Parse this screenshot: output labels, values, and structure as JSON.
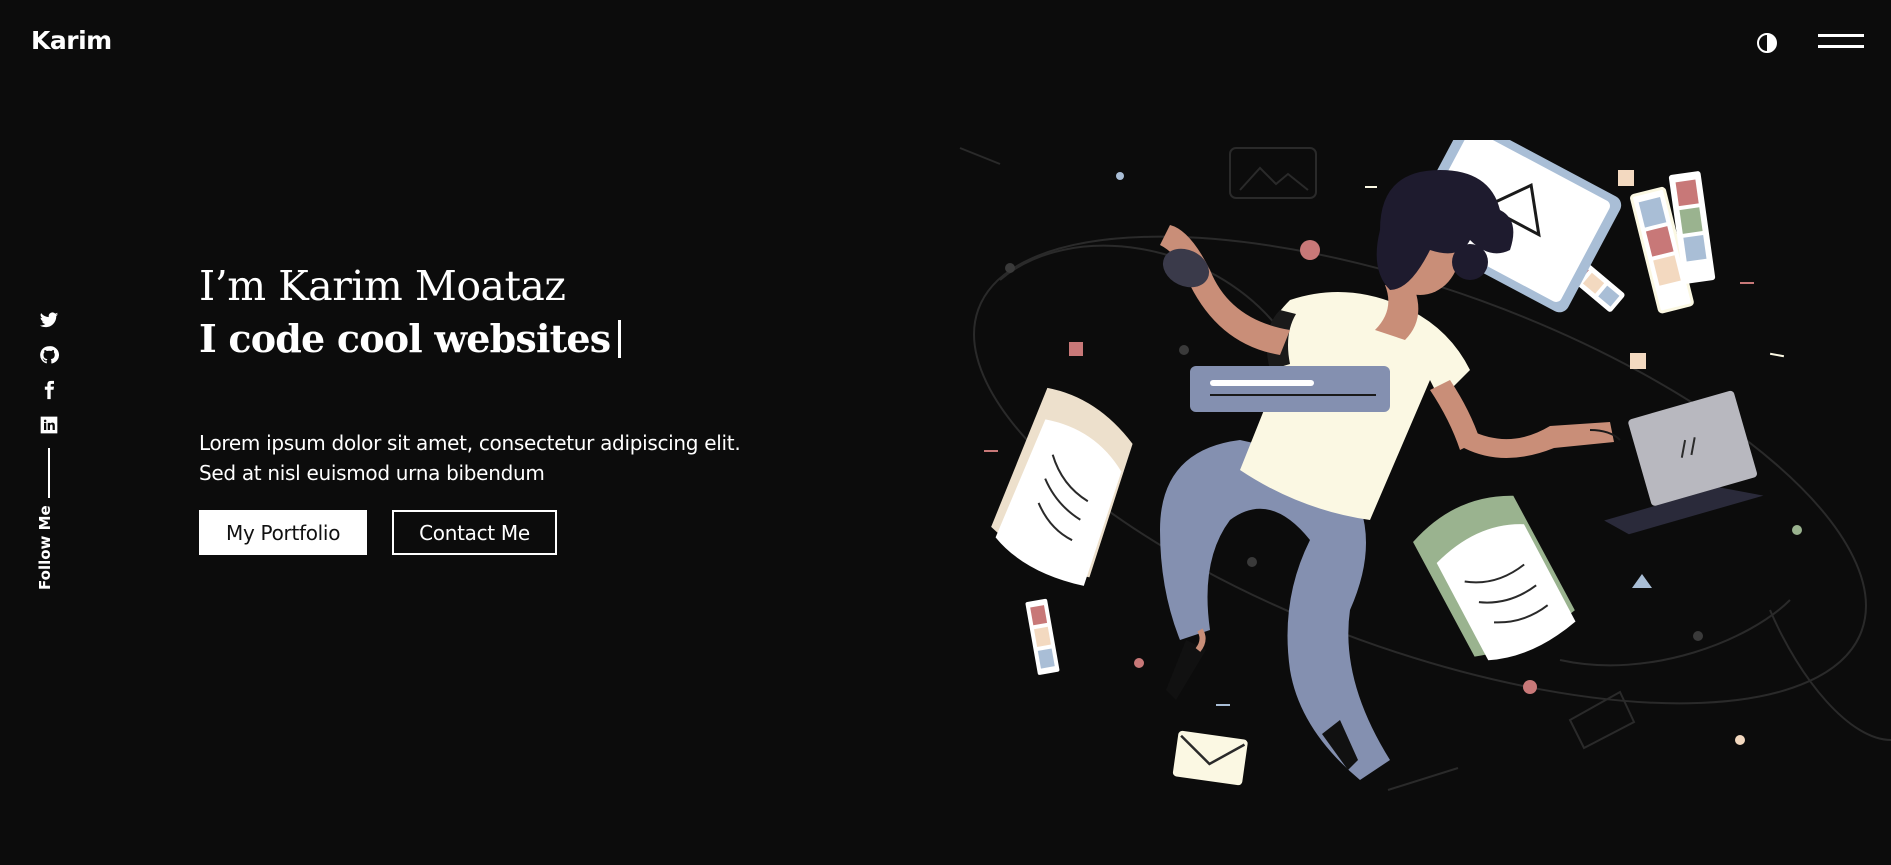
{
  "header": {
    "logo": "Karim",
    "theme_toggle_icon": "contrast-icon",
    "menu_icon": "hamburger-menu-icon"
  },
  "social": {
    "items": [
      {
        "name": "twitter",
        "icon": "twitter-icon"
      },
      {
        "name": "github",
        "icon": "github-icon"
      },
      {
        "name": "facebook",
        "icon": "facebook-icon"
      },
      {
        "name": "linkedin",
        "icon": "linkedin-icon"
      }
    ],
    "follow_label": "Follow Me"
  },
  "hero": {
    "intro": "I’m Karim Moataz",
    "tagline": "I code cool websites",
    "description": "Lorem ipsum dolor sit amet, consectetur adipiscing elit. Sed at nisl euismod urna bibendum",
    "primary_button": "My Portfolio",
    "secondary_button": "Contact Me"
  },
  "colors": {
    "background": "#0c0c0c",
    "text": "#ffffff",
    "skin": "#c98e78",
    "shirt": "#fbf8e3",
    "pants": "#8490b0",
    "accent_red": "#c87878",
    "accent_green": "#9ab38f",
    "accent_blue": "#a9bed6",
    "laptop": "#b8b8bf"
  }
}
